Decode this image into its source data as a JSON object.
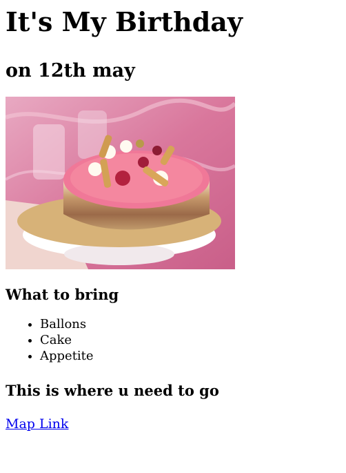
{
  "page": {
    "title": "It's My Birthday",
    "subtitle": "on 12th may",
    "image": {
      "alt": "cake-photo"
    },
    "bring_heading": "What to bring",
    "bring_items": [
      "Ballons",
      "Cake",
      "Appetite"
    ],
    "directions_heading": "This is where u need to go",
    "map_link_label": "Map Link"
  }
}
